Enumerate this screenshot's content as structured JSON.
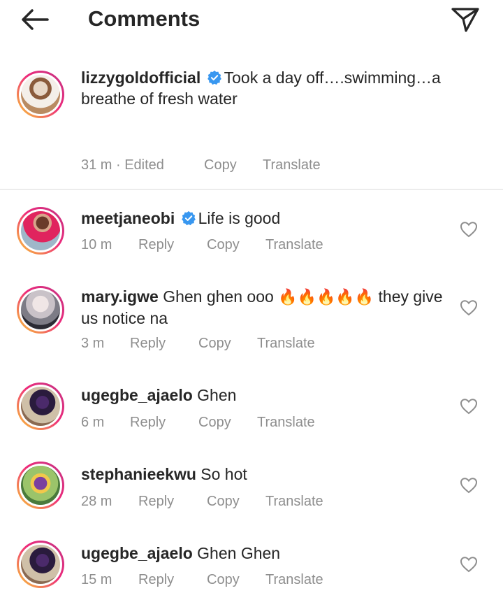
{
  "header": {
    "title": "Comments",
    "back_icon": "arrow-left-icon",
    "send_icon": "paper-plane-icon"
  },
  "caption": {
    "username": "lizzygoldofficial",
    "verified": true,
    "text": "Took a day off….swimming…a breathe of fresh water",
    "time": "31 m",
    "edited": "· Edited",
    "copy": "Copy",
    "translate": "Translate"
  },
  "comments": [
    {
      "username": "meetjaneobi",
      "verified": true,
      "text": "Life is good",
      "time": "10 m",
      "reply": "Reply",
      "copy": "Copy",
      "translate": "Translate"
    },
    {
      "username": "mary.igwe",
      "verified": false,
      "text_before": "Ghen ghen ooo",
      "emojis": "🔥🔥🔥🔥🔥",
      "text_after": "they give us notice na",
      "time": "3 m",
      "reply": "Reply",
      "copy": "Copy",
      "translate": "Translate"
    },
    {
      "username": "ugegbe_ajaelo",
      "verified": false,
      "text": "Ghen",
      "time": "6 m",
      "reply": "Reply",
      "copy": "Copy",
      "translate": "Translate"
    },
    {
      "username": "stephanieekwu",
      "verified": false,
      "text": "So hot",
      "time": "28 m",
      "reply": "Reply",
      "copy": "Copy",
      "translate": "Translate"
    },
    {
      "username": "ugegbe_ajaelo",
      "verified": false,
      "text": "Ghen Ghen",
      "time": "15 m",
      "reply": "Reply",
      "copy": "Copy",
      "translate": "Translate"
    }
  ],
  "colors": {
    "text": "#262626",
    "meta": "#8e8e8e",
    "verified": "#3897f0",
    "divider": "#dbdbdb"
  }
}
